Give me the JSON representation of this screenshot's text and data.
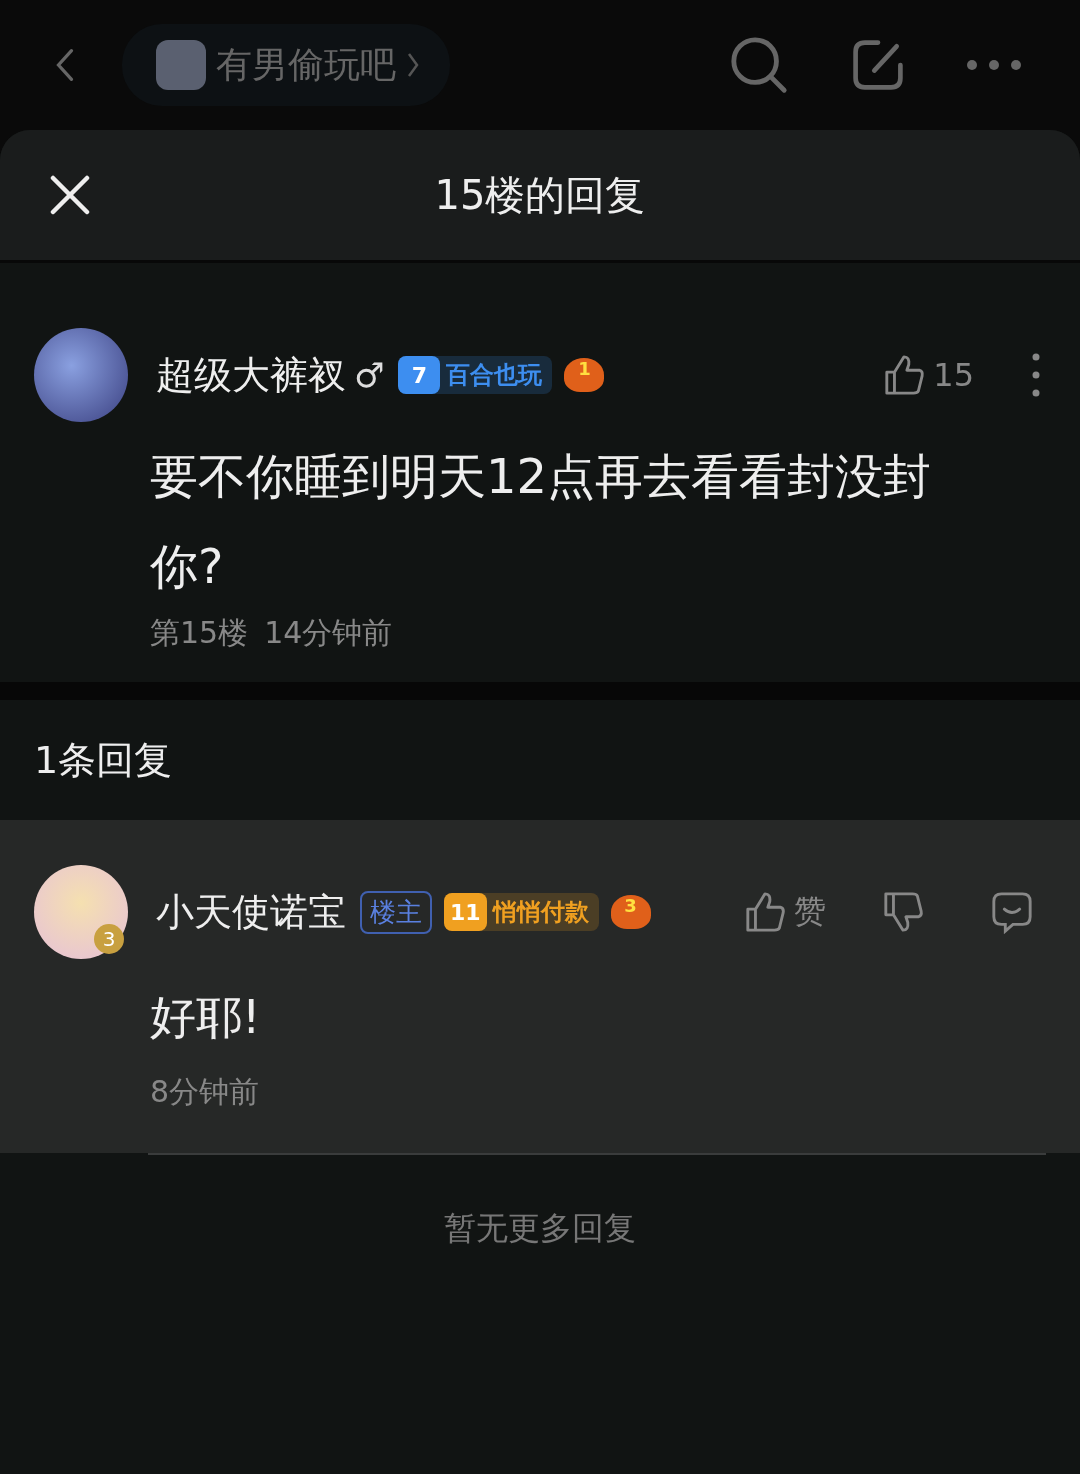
{
  "top_bar": {
    "forum_name": "有男偷玩吧"
  },
  "sheet": {
    "title": "15楼的回复"
  },
  "post": {
    "author": "超级大裤衩",
    "gender": "♂",
    "level_badge": {
      "level": "7",
      "title": "百合也玩",
      "color": "#3d8ef0"
    },
    "medal": "1",
    "likes": "15",
    "content": "要不你睡到明天12点再去看看封没封你?",
    "floor": "第15楼",
    "time": "14分钟前"
  },
  "replies_header": "1条回复",
  "replies": [
    {
      "author": "小天使诺宝",
      "avatar_badge": "3",
      "owner_tag": "楼主",
      "level_badge": {
        "level": "11",
        "title": "悄悄付款",
        "color": "#f0a020"
      },
      "medal": "3",
      "like_label": "赞",
      "content": "好耶!",
      "time": "8分钟前"
    }
  ],
  "footer": "暂无更多回复"
}
